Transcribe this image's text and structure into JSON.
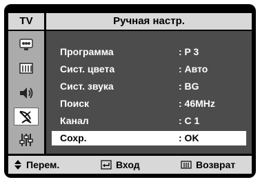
{
  "header": {
    "tab_label": "TV",
    "title": "Ручная настр."
  },
  "sidebar": {
    "icons": [
      {
        "name": "picture-icon"
      },
      {
        "name": "sound-icon"
      },
      {
        "name": "speaker-icon"
      },
      {
        "name": "channel-antenna-icon",
        "active": true
      },
      {
        "name": "setup-sliders-icon"
      }
    ]
  },
  "menu": {
    "rows": [
      {
        "label": "Программа",
        "value": ": P 3"
      },
      {
        "label": "Сист. цвета",
        "value": ": Авто"
      },
      {
        "label": "Сист. звука",
        "value": ": BG"
      },
      {
        "label": "Поиск",
        "value": ": 46MHz"
      },
      {
        "label": "Канал",
        "value": ": C 1"
      },
      {
        "label": "Сохр.",
        "value": ": OK",
        "selected": true
      }
    ]
  },
  "footer": {
    "move_label": "Перем.",
    "enter_label": "Вход",
    "return_label": "Возврат"
  },
  "colors": {
    "frame": "#000000",
    "bar": "#d8d8d8",
    "panel": "#4c4c4c",
    "sidebar": "#ababab",
    "highlight": "#ffffff"
  }
}
